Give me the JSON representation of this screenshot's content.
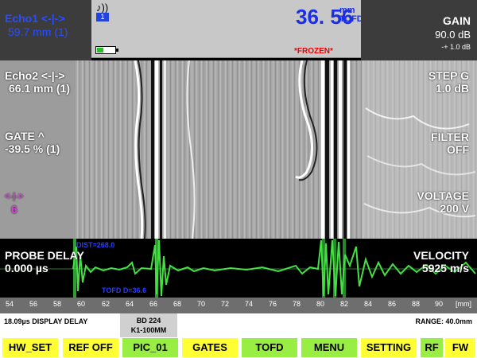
{
  "status": {
    "echo1_label": "Echo1 <-|->",
    "echo1_value": "59.7 mm (1)",
    "channel": "1",
    "main_value": "36. 56",
    "main_unit": "mm",
    "main_mode": "TOFD",
    "frozen": "*FROZEN*",
    "battery_level": 0.35,
    "gain_label": "GAIN",
    "gain_value": "90.0 dB",
    "gain_step": "-+ 1.0 dB"
  },
  "overlay": {
    "echo2_label": "Echo2 <-|->",
    "echo2_value": "66.1 mm (1)",
    "gate_label": "GATE ^",
    "gate_value": "-39.5 % (1)",
    "cursor_label": "<-|->",
    "cursor_value": "6",
    "step_label": "STEP G",
    "step_value": "1.0 dB",
    "filter_label": "FILTER",
    "filter_value": "OFF",
    "voltage_label": "VOLTAGE",
    "voltage_value": "200 V",
    "probe_delay_label": "PROBE DELAY",
    "probe_delay_value": "0.000 µs",
    "velocity_label": "VELOCITY",
    "velocity_value": "5925 m/s"
  },
  "ascan": {
    "dist_annotation": "DIST=268.0",
    "tofd_annotation": "TOFD D=36.6"
  },
  "axis": {
    "ticks": [
      "54",
      "56",
      "58",
      "60",
      "62",
      "64",
      "66",
      "68",
      "70",
      "72",
      "74",
      "76",
      "78",
      "80",
      "82",
      "84",
      "86",
      "88",
      "90"
    ],
    "unit": "[mm]"
  },
  "info": {
    "display_delay": "18.09µs  DISPLAY DELAY",
    "probe_line1": "BD 224",
    "probe_line2": "K1-100MM",
    "range": "RANGE: 40.0mm"
  },
  "buttons": [
    {
      "label": "HW_SET",
      "color": "#ffff33"
    },
    {
      "label": "REF OFF",
      "color": "#ffff33"
    },
    {
      "label": "PIC_01",
      "color": "#99ee44"
    },
    {
      "label": "GATES",
      "color": "#ffff33"
    },
    {
      "label": "TOFD",
      "color": "#99ee44"
    },
    {
      "label": "MENU",
      "color": "#99ee44"
    },
    {
      "label": "SETTING",
      "color": "#ffff33"
    },
    {
      "label": "RF",
      "color": "#99ee44"
    },
    {
      "label": "FW",
      "color": "#ffff33"
    }
  ]
}
